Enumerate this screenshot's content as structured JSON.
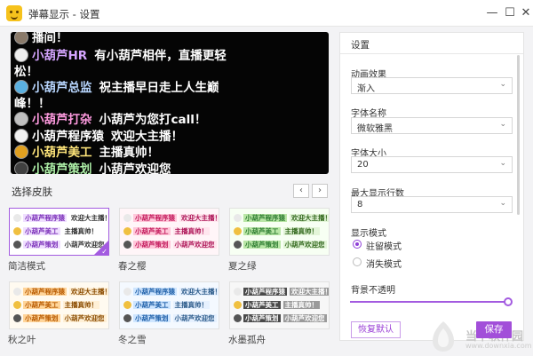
{
  "window": {
    "title": "弹幕显示 - 设置",
    "min_icon": "—",
    "max_icon": "☐",
    "close_icon": "✕"
  },
  "preview": {
    "lines": [
      {
        "name": "",
        "message": "播间！",
        "name_color": "#ffffff",
        "avatar": "#8a7a6a"
      },
      {
        "name": "小葫芦HR",
        "message": "有小葫芦相伴，直播更轻",
        "name_color": "#d5a5ff",
        "avatar": "#eeeeee"
      },
      {
        "name": "",
        "message": "松！",
        "name_color": "#ffffff",
        "avatar": ""
      },
      {
        "name": "小葫芦总监",
        "message": "祝主播早日走上人生巅",
        "name_color": "#b8d6ff",
        "avatar": "#5ab0e0"
      },
      {
        "name": "",
        "message": "峰！！",
        "name_color": "#ffffff",
        "avatar": ""
      },
      {
        "name": "小葫芦打杂",
        "message": "小葫芦为您打call！",
        "name_color": "#ff9be0",
        "avatar": "#c0c0c0"
      },
      {
        "name": "小葫芦程序猿",
        "message": "欢迎大主播！",
        "name_color": "#ffffff",
        "avatar": "#f1f1f1"
      },
      {
        "name": "小葫芦美工",
        "message": "主播真帅！",
        "name_color": "#ffe57a",
        "avatar": "#e0a020"
      },
      {
        "name": "小葫芦策划",
        "message": "小葫芦欢迎您",
        "name_color": "#aef0a8",
        "avatar": "#404040"
      }
    ]
  },
  "skins": {
    "title": "选择皮肤",
    "prev_icon": "‹",
    "next_icon": "›",
    "sample_rows": [
      {
        "name": "小葫芦程序猿",
        "message": "欢迎大主播！"
      },
      {
        "name": "小葫芦美工",
        "message": "主播真帅！"
      },
      {
        "name": "小葫芦策划",
        "message": "小葫芦欢迎您"
      }
    ],
    "items": [
      {
        "label": "简洁模式",
        "selected": true,
        "bg": "#ffffff",
        "name_bg": "#f0e0ff",
        "name_color": "#7a2fb8",
        "msg_bg": "#ffffff",
        "msg_color": "#333333"
      },
      {
        "label": "春之樱",
        "selected": false,
        "bg": "#fff5f8",
        "name_bg": "#ffc8da",
        "name_color": "#c2185b",
        "msg_bg": "#ffe6ee",
        "msg_color": "#ad1457"
      },
      {
        "label": "夏之绿",
        "selected": false,
        "bg": "#f7fff3",
        "name_bg": "#b9e6a6",
        "name_color": "#2e7d32",
        "msg_bg": "#e3f5d8",
        "msg_color": "#33691e"
      },
      {
        "label": "秋之叶",
        "selected": false,
        "bg": "#fffaf0",
        "name_bg": "#ffd59a",
        "name_color": "#b85a00",
        "msg_bg": "#fff0d6",
        "msg_color": "#8a4b00"
      },
      {
        "label": "冬之雪",
        "selected": false,
        "bg": "#f4f9ff",
        "name_bg": "#cfe6ff",
        "name_color": "#1e5fa8",
        "msg_bg": "#e6f1ff",
        "msg_color": "#2c5b8a"
      },
      {
        "label": "水墨孤舟",
        "selected": false,
        "bg": "#f7f7f7",
        "name_bg": "#4a4a4a",
        "name_color": "#ffffff",
        "msg_bg": "#9a9a9a",
        "msg_color": "#ffffff"
      }
    ]
  },
  "settings": {
    "title": "设置",
    "animation": {
      "label": "动画效果",
      "value": "渐入"
    },
    "font": {
      "label": "字体名称",
      "value": "微软雅黑"
    },
    "size": {
      "label": "字体大小",
      "value": "20"
    },
    "max_lines": {
      "label": "最大显示行数",
      "value": "8"
    },
    "display_mode": {
      "label": "显示模式",
      "options": [
        {
          "label": "驻留模式",
          "checked": true
        },
        {
          "label": "消失模式",
          "checked": false
        }
      ]
    },
    "opacity": {
      "label": "背景不透明",
      "value": 1.0
    },
    "chevron_icon": "⌄",
    "reset_label": "恢复默认",
    "save_label": "保存"
  },
  "watermark": {
    "text": "当下软件园",
    "url": "www.downxia.com"
  },
  "colors": {
    "accent": "#a24fd9"
  }
}
